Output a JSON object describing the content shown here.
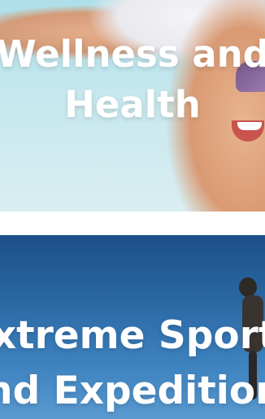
{
  "cards": [
    {
      "title_line1": "Wellness and",
      "title_line2": "Health"
    },
    {
      "title_line1": "Extreme Sports",
      "title_line2": "and Expeditions"
    }
  ]
}
